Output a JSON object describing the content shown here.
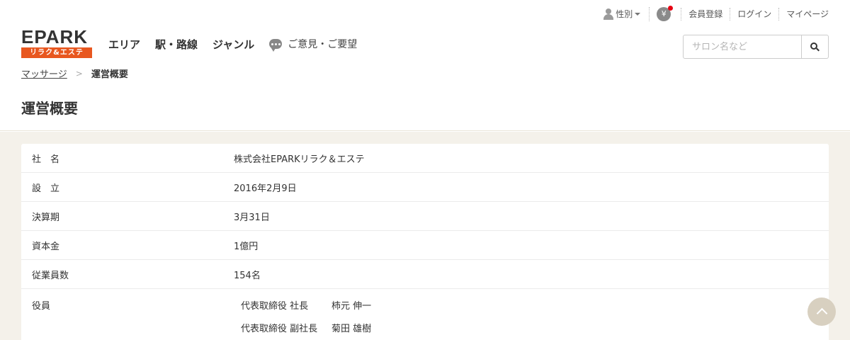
{
  "utility_nav": {
    "gender_label": "性別",
    "notification_badge": "¥",
    "register_label": "会員登録",
    "login_label": "ログイン",
    "mypage_label": "マイページ"
  },
  "logo": {
    "top_text": "EPARK",
    "sub_text": "リラク&エステ"
  },
  "global_nav": {
    "area_label": "エリア",
    "station_label": "駅・路線",
    "genre_label": "ジャンル",
    "opinion_label": "ご意見・ご要望"
  },
  "search": {
    "placeholder": "サロン名など"
  },
  "breadcrumb": {
    "parent_label": "マッサージ",
    "separator": ">",
    "current_label": "運営概要"
  },
  "page_title": "運営概要",
  "company_info": {
    "rows": [
      {
        "label": "社　名",
        "value": "株式会社EPARKリラク＆エステ"
      },
      {
        "label": "設　立",
        "value": "2016年2月9日"
      },
      {
        "label": "決算期",
        "value": "3月31日"
      },
      {
        "label": "資本金",
        "value": "1億円"
      },
      {
        "label": "従業員数",
        "value": "154名"
      }
    ],
    "officers_label": "役員",
    "officers": [
      {
        "role": "代表取締役 社長",
        "name": "柿元 伸一"
      },
      {
        "role": "代表取締役 副社長",
        "name": "菊田 雄樹"
      }
    ]
  },
  "colors": {
    "brand_orange": "#e8571f",
    "brand_green": "#7dbe2b",
    "content_background": "#f4f1ea",
    "notification_dot": "#e60012"
  }
}
